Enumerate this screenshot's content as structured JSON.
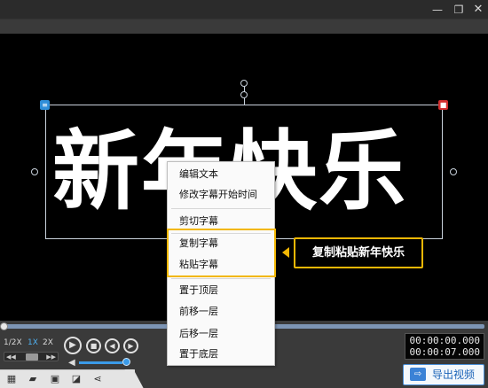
{
  "window": {
    "minimize_icon": "minimize-icon",
    "maximize_icon": "restore-icon",
    "close_icon": "close-icon",
    "minimize_glyph": "—",
    "maximize_glyph": "❐",
    "close_glyph": "✕"
  },
  "stage": {
    "subtitle_text": "新年快乐",
    "edit_glyph": "≡",
    "delete_glyph": "■"
  },
  "context_menu": {
    "items": [
      {
        "label": "编辑文本"
      },
      {
        "label": "修改字幕开始时间"
      },
      {
        "label": "剪切字幕"
      },
      {
        "label": "复制字幕"
      },
      {
        "label": "粘贴字幕"
      },
      {
        "label": "置于顶层"
      },
      {
        "label": "前移一层"
      },
      {
        "label": "后移一层"
      },
      {
        "label": "置于底层"
      }
    ]
  },
  "callout": {
    "text": "复制粘贴新年快乐"
  },
  "player": {
    "progress": 0.0,
    "speeds": [
      "1/2X",
      "1X",
      "2X"
    ],
    "active_speed": "1X",
    "jog_left": "◀◀",
    "jog_right": "▶▶",
    "play_glyph": "▶",
    "stop_glyph": "■",
    "prev_glyph": "◀",
    "next_glyph": "▶",
    "volume_glyph": "◀",
    "volume_level": 0.9,
    "current_time": "00:00:00.000",
    "total_time": "00:00:07.000"
  },
  "toolbar": {
    "icons": [
      {
        "name": "subtitle-edit-icon",
        "glyph": "▦"
      },
      {
        "name": "open-folder-icon",
        "glyph": "▰"
      },
      {
        "name": "save-icon",
        "glyph": "▣"
      },
      {
        "name": "save-as-icon",
        "glyph": "◪"
      },
      {
        "name": "share-icon",
        "glyph": "⋖"
      }
    ]
  },
  "export": {
    "label": "导出视频",
    "glyph": "⇨"
  },
  "colors": {
    "accent_blue": "#3b82d6",
    "highlight_yellow": "#f2b705",
    "delete_red": "#d33030"
  }
}
